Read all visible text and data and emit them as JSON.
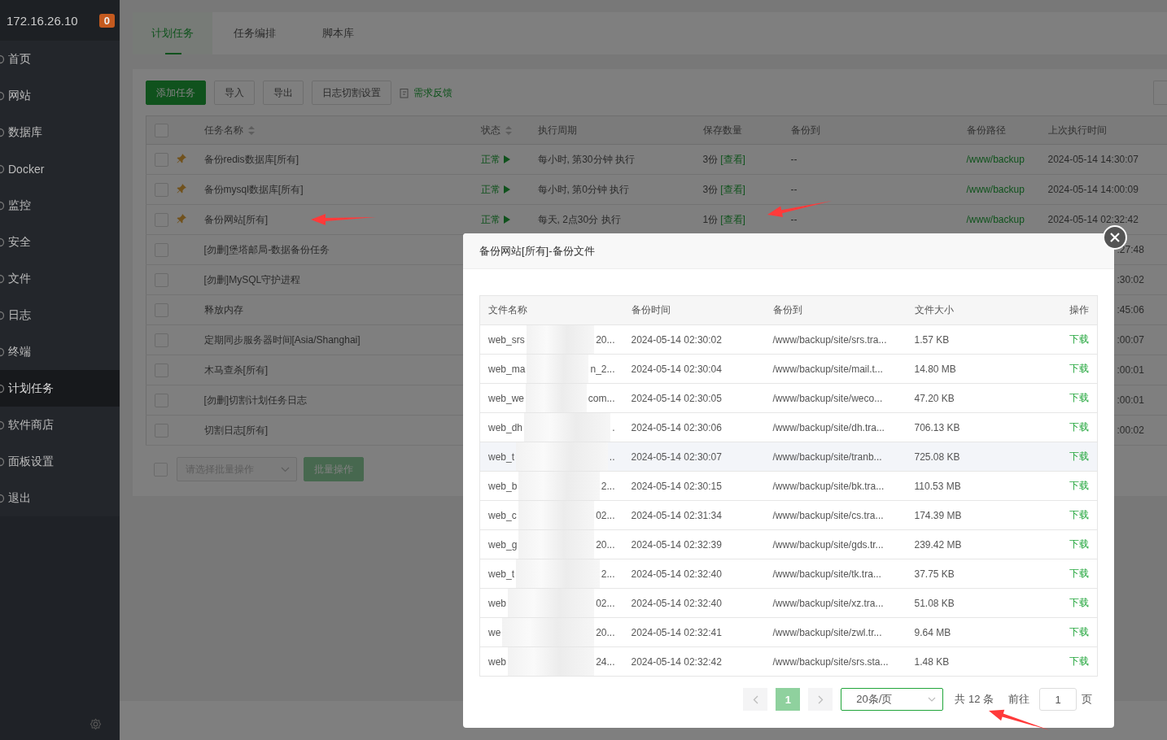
{
  "sidebar": {
    "host": "172.16.26.10",
    "badge": "0",
    "items": [
      {
        "label": "首页",
        "selected": false
      },
      {
        "label": "网站",
        "selected": false
      },
      {
        "label": "数据库",
        "selected": false
      },
      {
        "label": "Docker",
        "selected": false
      },
      {
        "label": "监控",
        "selected": false
      },
      {
        "label": "安全",
        "selected": false
      },
      {
        "label": "文件",
        "selected": false
      },
      {
        "label": "日志",
        "selected": false
      },
      {
        "label": "终端",
        "selected": false
      },
      {
        "label": "计划任务",
        "selected": true
      },
      {
        "label": "软件商店",
        "selected": false
      },
      {
        "label": "面板设置",
        "selected": false
      },
      {
        "label": "退出",
        "selected": false
      }
    ]
  },
  "tabs": [
    {
      "label": "计划任务",
      "selected": true
    },
    {
      "label": "任务编排",
      "selected": false
    },
    {
      "label": "脚本库",
      "selected": false
    }
  ],
  "toolbar": [
    {
      "label": "添加任务",
      "kind": "primary"
    },
    {
      "label": "导入",
      "kind": "default"
    },
    {
      "label": "导出",
      "kind": "default"
    },
    {
      "label": "日志切割设置",
      "kind": "default"
    },
    {
      "label": "需求反馈",
      "kind": "link"
    }
  ],
  "table": {
    "header_checked": false,
    "columns": [
      {
        "label": "任务名称",
        "sortable": true
      },
      {
        "label": "状态",
        "sortable": true
      },
      {
        "label": "执行周期",
        "sortable": false
      },
      {
        "label": "保存数量",
        "sortable": false
      },
      {
        "label": "备份到",
        "sortable": false
      },
      {
        "label": "备份路径",
        "sortable": false
      },
      {
        "label": "上次执行时间",
        "sortable": false
      }
    ],
    "rows": [
      {
        "checked": false,
        "pinned": true,
        "name": "备份redis数据库[所有]",
        "status": "正常",
        "period": "每小时, 第30分钟 执行",
        "count": "3份",
        "view": "[查看]",
        "backup_to": "--",
        "path": "/www/backup",
        "last_run": "2024-05-14 14:30:07"
      },
      {
        "checked": false,
        "pinned": true,
        "name": "备份mysql数据库[所有]",
        "status": "正常",
        "period": "每小时, 第0分钟 执行",
        "count": "3份",
        "view": "[查看]",
        "backup_to": "--",
        "path": "/www/backup",
        "last_run": "2024-05-14 14:00:09"
      },
      {
        "checked": false,
        "pinned": true,
        "name": "备份网站[所有]",
        "status": "正常",
        "period": "每天, 2点30分 执行",
        "count": "1份",
        "view": "[查看]",
        "backup_to": "--",
        "path": "/www/backup",
        "last_run": "2024-05-14 02:32:42"
      },
      {
        "checked": false,
        "pinned": false,
        "name": "[勿删]堡塔邮局-数据备份任务",
        "last_run_tail": ":27:48"
      },
      {
        "checked": false,
        "pinned": false,
        "name": "[勿删]MySQL守护进程",
        "last_run_tail": ":30:02"
      },
      {
        "checked": false,
        "pinned": false,
        "name": "释放内存",
        "last_run_tail": ":45:06"
      },
      {
        "checked": false,
        "pinned": false,
        "name": "定期同步服务器时间[Asia/Shanghai]",
        "last_run_tail": ":00:07"
      },
      {
        "checked": false,
        "pinned": false,
        "name": "木马查杀[所有]",
        "last_run_tail": ":00:01"
      },
      {
        "checked": false,
        "pinned": false,
        "name": "[勿删]切割计划任务日志",
        "last_run_tail": ":00:01"
      },
      {
        "checked": false,
        "pinned": false,
        "name": "切割日志[所有]",
        "last_run_tail": ":00:02"
      }
    ]
  },
  "batch": {
    "checked": false,
    "placeholder": "请选择批量操作",
    "button": "批量操作",
    "disabled": true
  },
  "dialog": {
    "title": "备份网站[所有]-备份文件",
    "columns": [
      "文件名称",
      "备份时间",
      "备份到",
      "文件大小",
      "操作"
    ],
    "rows": [
      {
        "name_start": "web_srs",
        "name_end": "20...",
        "time": "2024-05-14 02:30:02",
        "to": "/www/backup/site/srs.tra...",
        "size": "1.57 KB",
        "action": "下载",
        "highlighted": false
      },
      {
        "name_start": "web_ma",
        "name_end": "n_2...",
        "time": "2024-05-14 02:30:04",
        "to": "/www/backup/site/mail.t...",
        "size": "14.80 MB",
        "action": "下载",
        "highlighted": false
      },
      {
        "name_start": "web_we",
        "name_end": "com...",
        "time": "2024-05-14 02:30:05",
        "to": "/www/backup/site/weco...",
        "size": "47.20 KB",
        "action": "下载",
        "highlighted": false
      },
      {
        "name_start": "web_dh",
        "name_end": ".",
        "time": "2024-05-14 02:30:06",
        "to": "/www/backup/site/dh.tra...",
        "size": "706.13 KB",
        "action": "下载",
        "highlighted": false
      },
      {
        "name_start": "web_t",
        "name_end": "..",
        "time": "2024-05-14 02:30:07",
        "to": "/www/backup/site/tranb...",
        "size": "725.08 KB",
        "action": "下载",
        "highlighted": true
      },
      {
        "name_start": "web_b",
        "name_end": "2...",
        "time": "2024-05-14 02:30:15",
        "to": "/www/backup/site/bk.tra...",
        "size": "110.53 MB",
        "action": "下载",
        "highlighted": false
      },
      {
        "name_start": "web_c",
        "name_end": "02...",
        "time": "2024-05-14 02:31:34",
        "to": "/www/backup/site/cs.tra...",
        "size": "174.39 MB",
        "action": "下载",
        "highlighted": false
      },
      {
        "name_start": "web_g",
        "name_end": "20...",
        "time": "2024-05-14 02:32:39",
        "to": "/www/backup/site/gds.tr...",
        "size": "239.42 MB",
        "action": "下载",
        "highlighted": false
      },
      {
        "name_start": "web_t",
        "name_end": "2...",
        "time": "2024-05-14 02:32:40",
        "to": "/www/backup/site/tk.tra...",
        "size": "37.75 KB",
        "action": "下载",
        "highlighted": false
      },
      {
        "name_start": "web",
        "name_end": "02...",
        "time": "2024-05-14 02:32:40",
        "to": "/www/backup/site/xz.tra...",
        "size": "51.08 KB",
        "action": "下载",
        "highlighted": false
      },
      {
        "name_start": "we",
        "name_end": "20...",
        "time": "2024-05-14 02:32:41",
        "to": "/www/backup/site/zwl.tr...",
        "size": "9.64 MB",
        "action": "下载",
        "highlighted": false
      },
      {
        "name_start": "web",
        "name_end": "24...",
        "time": "2024-05-14 02:32:42",
        "to": "/www/backup/site/srs.sta...",
        "size": "1.48 KB",
        "action": "下载",
        "highlighted": false
      }
    ],
    "pagination": {
      "pages": [
        {
          "label": "1",
          "selected": true
        }
      ],
      "page_size": "20条/页",
      "total": "共 12 条",
      "goto_label": "前往",
      "goto_value": "1",
      "page_unit": "页"
    }
  }
}
